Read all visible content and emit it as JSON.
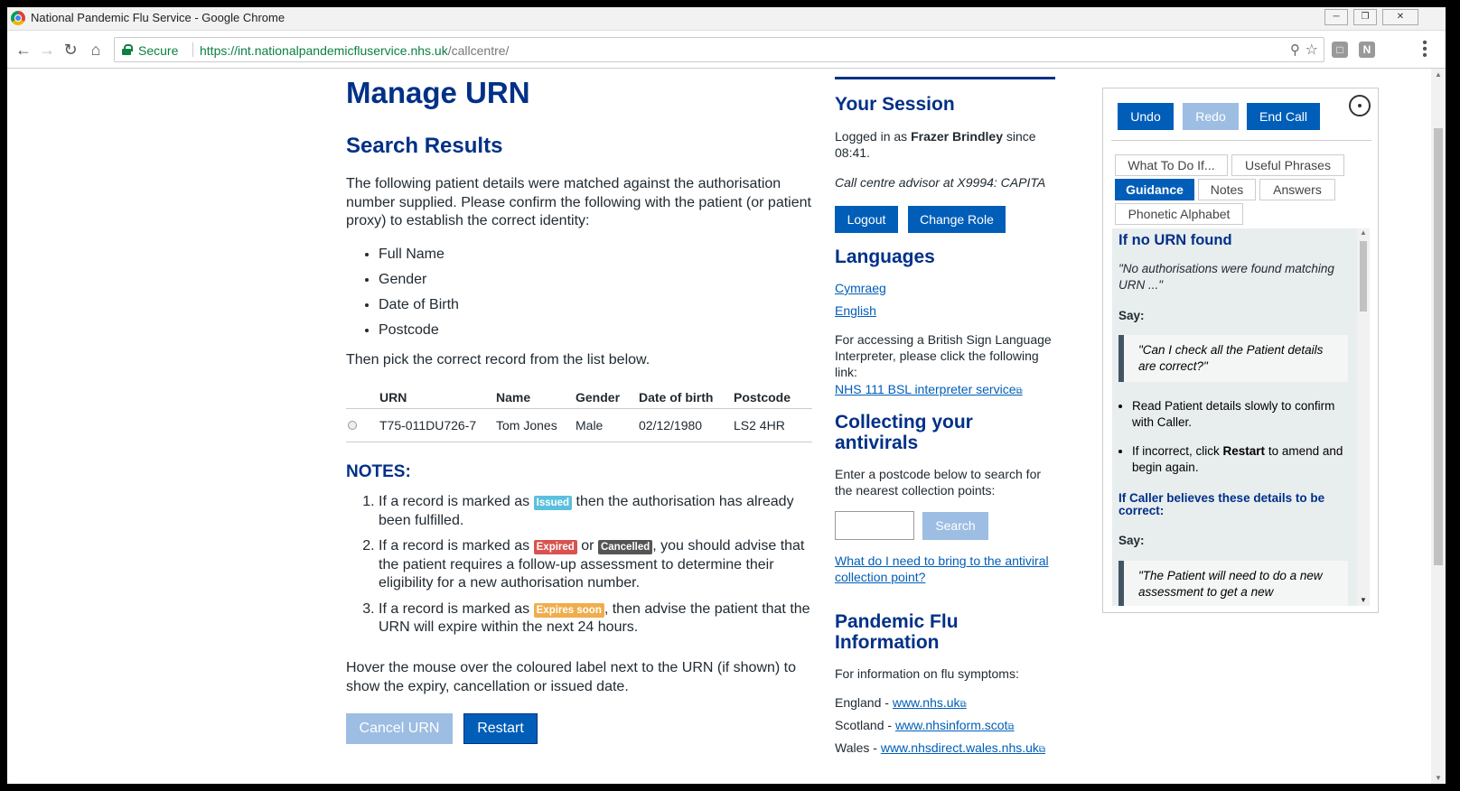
{
  "window": {
    "title": "National Pandemic Flu Service - Google Chrome"
  },
  "browser": {
    "secure_label": "Secure",
    "url_host": "https://int.nationalpandemicfluservice.nhs.uk",
    "url_path": "/callcentre/",
    "ext_n": "N"
  },
  "main": {
    "title": "Manage URN",
    "subtitle": "Search Results",
    "intro": "The following patient details were matched against the authorisation number supplied. Please confirm the following with the patient (or patient proxy) to establish the correct identity:",
    "fields": [
      "Full Name",
      "Gender",
      "Date of Birth",
      "Postcode"
    ],
    "pick": "Then pick the correct record from the list below.",
    "table": {
      "headers": [
        "URN",
        "Name",
        "Gender",
        "Date of birth",
        "Postcode"
      ],
      "rows": [
        {
          "urn": "T75-011DU726-7",
          "name": "Tom Jones",
          "gender": "Male",
          "dob": "02/12/1980",
          "postcode": "LS2 4HR"
        }
      ]
    },
    "notes_heading": "NOTES:",
    "notes": {
      "n1_a": "If a record is marked as ",
      "n1_tag": "Issued",
      "n1_b": " then the authorisation has already been fulfilled.",
      "n2_a": "If a record is marked as ",
      "n2_tag1": "Expired",
      "n2_or": " or ",
      "n2_tag2": "Cancelled",
      "n2_b": ", you should advise that the patient requires a follow-up assessment to determine their eligibility for a new authorisation number.",
      "n3_a": "If a record is marked as ",
      "n3_tag": "Expires soon",
      "n3_b": ", then advise the patient that the URN will expire within the next 24 hours."
    },
    "hover_text": "Hover the mouse over the coloured label next to the URN (if shown) to show the expiry, cancellation or issued date.",
    "cancel_label": "Cancel URN",
    "restart_label": "Restart"
  },
  "session": {
    "heading": "Your Session",
    "logged_in_prefix": "Logged in as ",
    "user": "Frazer Brindley",
    "logged_in_suffix": " since 08:41.",
    "role": "Call centre advisor at X9994: CAPITA",
    "logout_label": "Logout",
    "change_role_label": "Change Role",
    "languages_heading": "Languages",
    "lang_cy": "Cymraeg",
    "lang_en": "English",
    "bsl_text": "For accessing a British Sign Language Interpreter, please click the following link:",
    "bsl_link": "NHS 111 BSL interpreter service",
    "collect_heading": "Collecting your antivirals",
    "collect_text": "Enter a postcode below to search for the nearest collection points:",
    "search_label": "Search",
    "bring_link": "What do I need to bring to the antiviral collection point?",
    "flu_heading": "Pandemic Flu Information",
    "flu_text": "For information on flu symptoms:",
    "england_label": "England - ",
    "england_link": "www.nhs.uk",
    "scotland_label": "Scotland - ",
    "scotland_link": "www.nhsinform.scot",
    "wales_label": "Wales - ",
    "wales_link": "www.nhsdirect.wales.nhs.uk"
  },
  "panel": {
    "undo": "Undo",
    "redo": "Redo",
    "end_call": "End Call",
    "tabs": [
      "What To Do If...",
      "Useful Phrases",
      "Guidance",
      "Notes",
      "Answers",
      "Phonetic Alphabet"
    ],
    "active_tab": "Guidance",
    "guide": {
      "heading": "If no URN found",
      "quote1": "\"No authorisations were found matching URN ...\"",
      "say1": "Say:",
      "quote2": "\"Can I check all the Patient details are correct?\"",
      "bullet1": "Read Patient details slowly to confirm with Caller.",
      "bullet2_a": "If incorrect, click ",
      "bullet2_b": "Restart",
      "bullet2_c": " to amend and begin again.",
      "heading2": "If Caller believes these details to be correct:",
      "say2": "Say:",
      "quote3": "\"The Patient will need to do a new assessment to get a new"
    }
  }
}
